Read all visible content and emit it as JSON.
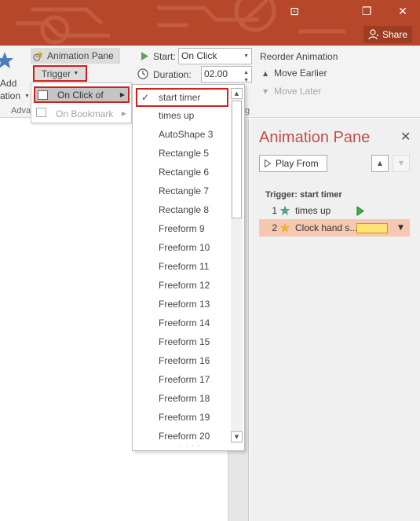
{
  "window": {
    "restore_glyph": "⊡",
    "maximize_glyph": "❐",
    "close_glyph": "✕",
    "share_label": "Share"
  },
  "ribbon": {
    "add_label_top": "Add",
    "add_label_bottom": "ation",
    "animation_pane_label": "Animation Pane",
    "trigger_label": "Trigger",
    "group_advanced": "Adva",
    "group_timing_tail": "g",
    "start_label": "Start:",
    "start_value": "On Click",
    "duration_label": "Duration:",
    "duration_value": "02.00",
    "reorder_label": "Reorder Animation",
    "move_earlier": "Move Earlier",
    "move_later": "Move Later"
  },
  "trigger_menu": {
    "on_click_of": "On Click of",
    "on_bookmark": "On Bookmark"
  },
  "click_of_list": {
    "items": [
      "start timer",
      "times up",
      "AutoShape 3",
      "Rectangle 5",
      "Rectangle 6",
      "Rectangle 7",
      "Rectangle 8",
      "Freeform 9",
      "Freeform 10",
      "Freeform 11",
      "Freeform 12",
      "Freeform 13",
      "Freeform 14",
      "Freeform 15",
      "Freeform 16",
      "Freeform 17",
      "Freeform 18",
      "Freeform 19",
      "Freeform 20"
    ],
    "checked_item": "start timer",
    "grip": "· · · ·"
  },
  "animation_pane": {
    "title": "Animation Pane",
    "play_from": "Play From",
    "trigger_heading": "Trigger: start timer",
    "rows": [
      {
        "num": "1",
        "label": "times up",
        "icon": "star-green-icon"
      },
      {
        "num": "2",
        "label": "Clock hand s...",
        "icon": "star-gold-icon"
      }
    ]
  },
  "colors": {
    "title_bar": "#b7472a",
    "highlight_border": "#d0201c",
    "pane_title": "#c0504d",
    "selected_row": "#f6c7b3",
    "timing_bar": "#ffe27a"
  }
}
